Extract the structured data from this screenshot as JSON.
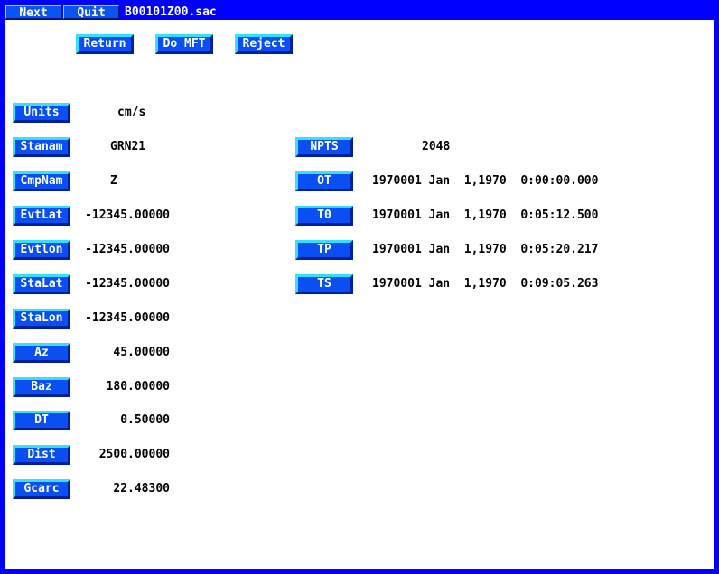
{
  "topbar": {
    "next_label": "Next",
    "quit_label": "Quit",
    "filename": "B00101Z00.sac"
  },
  "actions": {
    "return_label": "Return",
    "domft_label": "Do MFT",
    "reject_label": "Reject"
  },
  "left_fields": [
    {
      "label": "Units",
      "value": "cm/s"
    },
    {
      "label": "Stanam",
      "value": "GRN21"
    },
    {
      "label": "CmpNam",
      "value": "Z"
    },
    {
      "label": "EvtLat",
      "value": "-12345.00000"
    },
    {
      "label": "Evtlon",
      "value": "-12345.00000"
    },
    {
      "label": "StaLat",
      "value": "-12345.00000"
    },
    {
      "label": "StaLon",
      "value": "-12345.00000"
    },
    {
      "label": "Az",
      "value": "45.00000"
    },
    {
      "label": "Baz",
      "value": "180.00000"
    },
    {
      "label": "DT",
      "value": "0.50000"
    },
    {
      "label": "Dist",
      "value": "2500.00000"
    },
    {
      "label": "Gcarc",
      "value": "22.48300"
    }
  ],
  "right_fields": [
    {
      "label": "NPTS",
      "value": "2048"
    },
    {
      "label": "OT",
      "value": "1970001 Jan  1,1970  0:00:00.000"
    },
    {
      "label": "T0",
      "value": "1970001 Jan  1,1970  0:05:12.500"
    },
    {
      "label": "TP",
      "value": "1970001 Jan  1,1970  0:05:20.217"
    },
    {
      "label": "TS",
      "value": "1970001 Jan  1,1970  0:09:05.263"
    }
  ]
}
